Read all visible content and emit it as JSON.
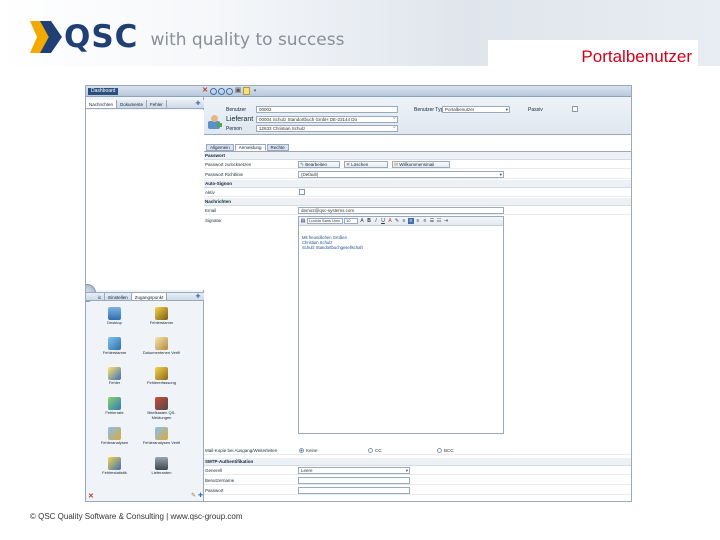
{
  "header": {
    "logo_text": "QSC",
    "tagline": "with quality to success",
    "title": "Portalbenutzer"
  },
  "footer": {
    "text": "© QSC Quality Software & Consulting | www.qsc-group.com"
  },
  "colors": {
    "brand_blue": "#1f3f75",
    "brand_orange": "#f2a900",
    "title_red": "#d4001a",
    "window_blue": "#2b4e7e"
  },
  "app": {
    "window_title": "Dashboard",
    "window_icons": [
      "close-icon",
      "circle-icon",
      "circle-icon",
      "circle-icon",
      "lock-icon",
      "page-icon",
      "dropdown-icon"
    ],
    "sidebar": {
      "tabs_top": [
        "Nachrichten",
        "Dokumente",
        "Fehler"
      ],
      "tabs_bottom": [
        "ic",
        "Einstellen",
        "Zugangspunkt"
      ],
      "icons": [
        {
          "label": "Desktop",
          "icon": "monitor-icon"
        },
        {
          "label": "Fehlerstamm",
          "icon": "pencil-icon"
        },
        {
          "label": "Fehlerstamm",
          "icon": "pencil-icon"
        },
        {
          "label": "Dokumentenen Verifi",
          "icon": "document-icon"
        },
        {
          "label": "Fehler",
          "icon": "pencil-icon"
        },
        {
          "label": "Fehlererfassung",
          "icon": "pencil-icon"
        },
        {
          "label": "Fehlerrate",
          "icon": "pencil-icon"
        },
        {
          "label": "Briefkasten QS-Meldungen",
          "icon": "mailbox-icon"
        },
        {
          "label": "Fehleranalysen",
          "icon": "pencil-icon"
        },
        {
          "label": "Fehleranalysen Verifi",
          "icon": "pencil-icon"
        },
        {
          "label": "Fehlerstatistik",
          "icon": "pencil-icon"
        },
        {
          "label": "Lieferanten",
          "icon": "building-icon"
        }
      ]
    },
    "form_header": {
      "benutzer_label": "Benutzer",
      "benutzer_value": "00002",
      "lieferant_label": "Lieferant",
      "lieferant_value": "00004  Schulz Standortbuch GmbH DE-23144 Dü",
      "person_label": "Person",
      "person_value": "12633  Christian Schulz",
      "benutzer_typ_label": "Benutzer Typ",
      "benutzer_typ_value": "Portalbenutzer",
      "passiv_label": "Passiv"
    },
    "tabs": [
      "Allgemein",
      "Anmeldung",
      "Rechte"
    ],
    "active_tab": 1,
    "sections": {
      "passwort": {
        "title": "Passwort",
        "zuruecksetzen_label": "Passwort zurücksetzen",
        "btn_bearbeiten": "Bearbeiten",
        "btn_loeschen": "Löschen",
        "btn_willkommensmail": "Willkommensmail",
        "richtlinie_label": "Passwort Richtlinie",
        "richtlinie_value": "(Default)"
      },
      "auto_signon": {
        "title": "Auto-Signon",
        "aktiv_label": "Aktiv"
      },
      "nachrichten": {
        "title": "Nachrichten",
        "email_label": "Email",
        "email_value": "demo2@qsc-systems.com",
        "signatur_label": "Signatur",
        "font_value": "Lucida Sans Unic",
        "size_value": "10",
        "signature_lines": [
          "Mit freundlichen Grüßen",
          "Christian Schulz",
          "Schulz Standortbuchgesellschaft"
        ]
      },
      "kopie": {
        "label": "Mail-Kopie bei Ausgang/Weiterleiten",
        "options": [
          "Keine",
          "CC",
          "BCC"
        ],
        "selected": 0
      },
      "smtp": {
        "title": "SMTP-Authentifikation",
        "generell_label": "Generell",
        "generell_value": "Leere",
        "benutzername_label": "Benutzername",
        "passwort_label": "Passwort"
      }
    }
  }
}
